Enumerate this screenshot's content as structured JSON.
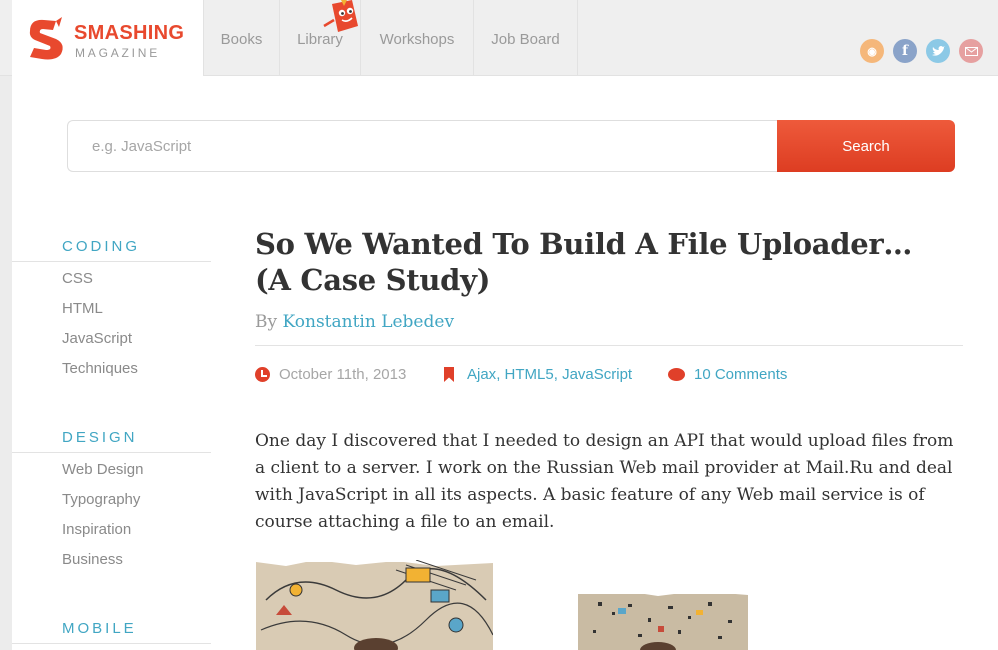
{
  "brand": {
    "name_line1": "SMASHING",
    "name_line2": "MAGAZINE"
  },
  "nav": {
    "items": [
      "Books",
      "Library",
      "Workshops",
      "Job Board"
    ]
  },
  "social": [
    "rss-icon",
    "facebook-icon",
    "twitter-icon",
    "mail-icon"
  ],
  "search": {
    "placeholder": "e.g. JavaScript",
    "button_label": "Search"
  },
  "sidebar": {
    "categories": [
      {
        "heading": "CODING",
        "links": [
          "CSS",
          "HTML",
          "JavaScript",
          "Techniques"
        ]
      },
      {
        "heading": "DESIGN",
        "links": [
          "Web Design",
          "Typography",
          "Inspiration",
          "Business"
        ]
      },
      {
        "heading": "MOBILE",
        "links": []
      }
    ]
  },
  "article": {
    "title": "So We Wanted To Build A File Uploader… (A Case Study)",
    "by_prefix": "By",
    "author": "Konstantin Lebedev",
    "date": "October 11th, 2013",
    "tags": [
      "Ajax",
      "HTML5",
      "JavaScript"
    ],
    "comments": "10 Comments",
    "intro": "One day I discovered that I needed to design an API that would upload files from a client to a server. I work on the Russian Web mail provider at Mail.Ru and deal with JavaScript in all its aspects. A basic feature of any Web mail service is of course attaching a file to an email."
  },
  "colors": {
    "accent": "#e8492e",
    "link": "#41a6c3",
    "muted": "#9a9a9a"
  }
}
